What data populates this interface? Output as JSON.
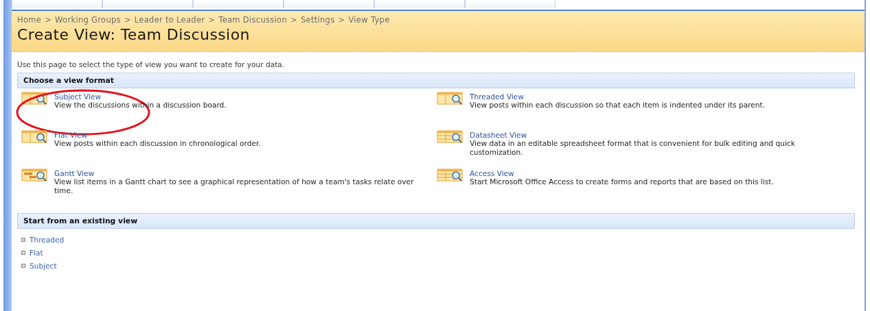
{
  "breadcrumb": [
    "Home",
    "Working Groups",
    "Leader to Leader",
    "Team Discussion",
    "Settings",
    "View Type"
  ],
  "breadcrumb_separator": ">",
  "title": "Create View: Team Discussion",
  "intro": "Use this page to select the type of view you want to create for your data.",
  "format_section": {
    "heading": "Choose a view format",
    "columns": [
      [
        {
          "kind": "list",
          "name": "Subject View",
          "description": "View the discussions within a discussion board.",
          "circled": true
        },
        {
          "kind": "list",
          "name": "Flat View",
          "description": "View posts within each discussion in chronological order.",
          "circled": false
        },
        {
          "kind": "gantt",
          "name": "Gantt View",
          "description": "View list items in a Gantt chart to see a graphical representation of how a team's tasks relate over time.",
          "circled": false
        }
      ],
      [
        {
          "kind": "list",
          "name": "Threaded View",
          "description": "View posts within each discussion so that each item is indented under its parent.",
          "circled": false
        },
        {
          "kind": "grid",
          "name": "Datasheet View",
          "description": "View data in an editable spreadsheet format that is convenient for bulk editing and quick customization.",
          "circled": false
        },
        {
          "kind": "grid",
          "name": "Access View",
          "description": "Start Microsoft Office Access to create forms and reports that are based on this list.",
          "circled": false
        }
      ]
    ]
  },
  "existing_section": {
    "heading": "Start from an existing view",
    "views": [
      "Threaded",
      "Flat",
      "Subject"
    ]
  }
}
